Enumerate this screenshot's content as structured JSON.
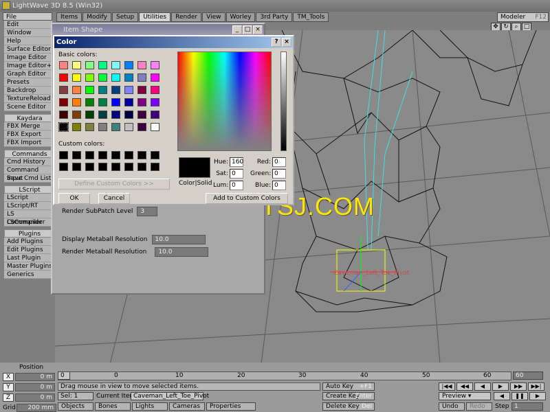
{
  "app": {
    "title": "LightWave 3D 8.5 (Win32)"
  },
  "tabs": [
    "Items",
    "Modify",
    "Setup",
    "Utilities",
    "Render",
    "View",
    "Worley",
    "3rd Party",
    "TM_Tools"
  ],
  "modeler": {
    "label": "Modeler",
    "hotkey": "F12"
  },
  "sidebar": {
    "file": "File",
    "top": [
      "Edit",
      "Window",
      "Help",
      "Surface Editor",
      "Image Editor",
      "Image Editor+",
      "Graph Editor",
      "Presets",
      "Backdrop",
      "TextureReload",
      "Scene Editor"
    ],
    "sections": [
      {
        "header": "Kaydara",
        "items": [
          "FBX Merge",
          "FBX Export",
          "FBX Import"
        ]
      },
      {
        "header": "Commands",
        "items": [
          "Cmd History",
          "Command Input",
          "Save Cmd List"
        ]
      },
      {
        "header": "LScript",
        "items": [
          "LScript",
          "LScript/RT",
          "LS Commander",
          "LSCompiler"
        ]
      },
      {
        "header": "Plugins",
        "items": [
          "Add Plugins",
          "Edit Plugins",
          "Last Plugin",
          "Master Plugins",
          "Generics"
        ]
      }
    ]
  },
  "item_shape": {
    "title": "Item Shape",
    "render_subdiv_label": "Render SubPatch Level",
    "render_subdiv_value": "3",
    "display_metaball_label": "Display Metaball Resolution",
    "display_metaball_value": "10.0",
    "render_metaball_label": "Render Metaball Resolution",
    "render_metaball_value": "10.0"
  },
  "color_dialog": {
    "title": "Color",
    "basic_label": "Basic colors:",
    "custom_label": "Custom colors:",
    "basic_colors": [
      "#ff8080",
      "#ffff80",
      "#80ff80",
      "#00ff80",
      "#80ffff",
      "#0080ff",
      "#ff80c0",
      "#ff80ff",
      "#ff0000",
      "#ffff00",
      "#80ff00",
      "#00ff40",
      "#00ffff",
      "#0080c0",
      "#8080c0",
      "#ff00ff",
      "#804040",
      "#ff8040",
      "#00ff00",
      "#008080",
      "#004080",
      "#8080ff",
      "#800040",
      "#ff0080",
      "#800000",
      "#ff8000",
      "#008000",
      "#008040",
      "#0000ff",
      "#0000a0",
      "#800080",
      "#8000ff",
      "#400000",
      "#804000",
      "#004000",
      "#004040",
      "#000080",
      "#000040",
      "#400040",
      "#400080",
      "#000000",
      "#808000",
      "#808040",
      "#808080",
      "#408080",
      "#c0c0c0",
      "#400040",
      "#ffffff"
    ],
    "define_custom": "Define Custom Colors >>",
    "ok": "OK",
    "cancel": "Cancel",
    "add_custom": "Add to Custom Colors",
    "color_solid": "Color|Solid",
    "hue_label": "Hue:",
    "hue": "160",
    "sat_label": "Sat:",
    "sat": "0",
    "lum_label": "Lum:",
    "lum": "0",
    "red_label": "Red:",
    "red": "0",
    "green_label": "Green:",
    "green": "0",
    "blue_label": "Blue:",
    "blue": "0"
  },
  "watermark": "WWW.CGTSJ.COM",
  "viewport": {
    "selected_label": "Caveman_Left_Toe_Pivot"
  },
  "bottom": {
    "position_label": "Position",
    "x_label": "X",
    "x": "0 m",
    "y_label": "Y",
    "y": "0 m",
    "z_label": "Z",
    "z": "0 m",
    "grid_label": "Grid:",
    "grid": "200 mm",
    "ticks": [
      "0",
      "10",
      "20",
      "30",
      "40",
      "50",
      "60"
    ],
    "frame": "0",
    "end_frame": "60",
    "message": "Drag mouse in view to move selected items.",
    "sel_label": "Sel:",
    "sel": "1",
    "current_item_label": "Current Item",
    "current_item": "Caveman_Left_Toe_Pivot",
    "objects": "Objects",
    "bones": "Bones",
    "lights": "Lights",
    "cameras": "Cameras",
    "properties": "Properties",
    "auto_key": "Auto Key",
    "create_key": "Create Key",
    "delete_key": "Delete Key",
    "auto_key_hk": "+F1",
    "create_key_hk": "Enter",
    "delete_key_hk": "Del",
    "preview": "Preview",
    "undo": "Undo",
    "redo": "Redo",
    "step_label": "Step",
    "step": "1"
  }
}
